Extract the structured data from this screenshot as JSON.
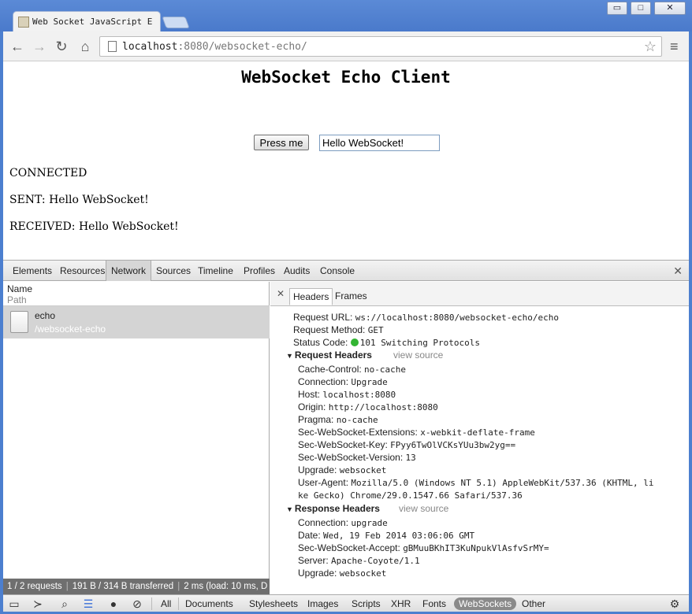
{
  "window": {
    "tab_title": "Web Socket JavaScript E",
    "minimize": "▭",
    "maximize": "□",
    "close": "✕"
  },
  "toolbar": {
    "url_host": "localhost",
    "url_rest": ":8080/websocket-echo/",
    "back_icon": "←",
    "forward_icon": "→",
    "reload_icon": "↻",
    "home_icon": "⌂",
    "star_icon": "☆",
    "menu_icon": "≡"
  },
  "page": {
    "title": "WebSocket Echo Client",
    "button_label": "Press me",
    "input_value": "Hello WebSocket!",
    "log": [
      "CONNECTED",
      "SENT: Hello WebSocket!",
      "RECEIVED: Hello WebSocket!"
    ]
  },
  "devtools": {
    "tabs": [
      "Elements",
      "Resources",
      "Network",
      "Sources",
      "Timeline",
      "Profiles",
      "Audits",
      "Console"
    ],
    "active_tab": "Network",
    "close_icon": "✕",
    "list": {
      "name_header": "Name",
      "path_header": "Path",
      "request_name": "echo",
      "request_path": "/websocket-echo"
    },
    "status": {
      "requests": "1 / 2 requests",
      "transferred": "191 B / 314 B transferred",
      "timing": "2 ms (load: 10 ms, D"
    },
    "detail": {
      "close_icon": "✕",
      "tabs": [
        "Headers",
        "Frames"
      ],
      "general": [
        {
          "k": "Request URL:",
          "v": "ws://localhost:8080/websocket-echo/echo"
        },
        {
          "k": "Request Method:",
          "v": "GET"
        },
        {
          "k": "Status Code:",
          "v": "101 Switching Protocols"
        }
      ],
      "request_headers_title": "Request Headers",
      "response_headers_title": "Response Headers",
      "view_source": "view source",
      "request_headers": [
        {
          "k": "Cache-Control:",
          "v": "no-cache"
        },
        {
          "k": "Connection:",
          "v": "Upgrade"
        },
        {
          "k": "Host:",
          "v": "localhost:8080"
        },
        {
          "k": "Origin:",
          "v": "http://localhost:8080"
        },
        {
          "k": "Pragma:",
          "v": "no-cache"
        },
        {
          "k": "Sec-WebSocket-Extensions:",
          "v": "x-webkit-deflate-frame"
        },
        {
          "k": "Sec-WebSocket-Key:",
          "v": "FPyy6TwOlVCKsYUu3bw2yg=="
        },
        {
          "k": "Sec-WebSocket-Version:",
          "v": "13"
        },
        {
          "k": "Upgrade:",
          "v": "websocket"
        },
        {
          "k": "User-Agent:",
          "v": "Mozilla/5.0 (Windows NT 5.1) AppleWebKit/537.36 (KHTML, li"
        }
      ],
      "user_agent_cont": "ke Gecko) Chrome/29.0.1547.66 Safari/537.36",
      "response_headers": [
        {
          "k": "Connection:",
          "v": "upgrade"
        },
        {
          "k": "Date:",
          "v": "Wed, 19 Feb 2014 03:06:06 GMT"
        },
        {
          "k": "Sec-WebSocket-Accept:",
          "v": "gBMuuBKhIT3KuNpukVlAsfvSrMY="
        },
        {
          "k": "Server:",
          "v": "Apache-Coyote/1.1"
        },
        {
          "k": "Upgrade:",
          "v": "websocket"
        }
      ]
    },
    "filters": [
      "All",
      "Documents",
      "Stylesheets",
      "Images",
      "Scripts",
      "XHR",
      "Fonts",
      "WebSockets",
      "Other"
    ],
    "active_filter": "WebSockets",
    "bottom_icons": {
      "dock": "▭",
      "console": "≻",
      "search": "⌕",
      "list": "☰",
      "record": "●",
      "clear": "⊘",
      "settings": "⚙"
    }
  }
}
